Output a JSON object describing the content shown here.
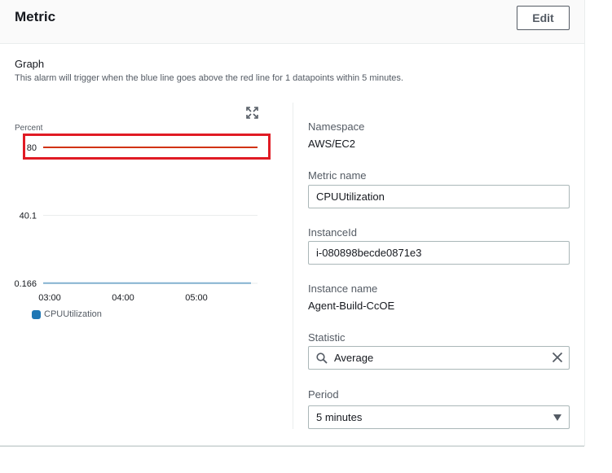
{
  "header": {
    "title": "Metric",
    "edit_label": "Edit"
  },
  "graph": {
    "title": "Graph",
    "description": "This alarm will trigger when the blue line goes above the red line for 1 datapoints within 5 minutes.",
    "expand_icon": "expand-icon"
  },
  "chart_data": {
    "type": "line",
    "ylabel": "Percent",
    "y_ticks": [
      "80",
      "40.1",
      "0.166"
    ],
    "x_ticks": [
      "03:00",
      "04:00",
      "05:00"
    ],
    "ylim": [
      0.166,
      80
    ],
    "threshold": {
      "value": 80,
      "color": "#d13212"
    },
    "series": [
      {
        "name": "CPUUtilization",
        "color": "#1f77b4",
        "values": [
          0.2,
          0.2,
          0.19,
          0.2,
          0.2,
          0.2,
          0.21,
          0.2,
          0.19,
          0.2,
          0.2,
          0.2
        ]
      }
    ]
  },
  "details": {
    "namespace_label": "Namespace",
    "namespace_value": "AWS/EC2",
    "metric_name_label": "Metric name",
    "metric_name_value": "CPUUtilization",
    "instance_id_label": "InstanceId",
    "instance_id_value": "i-080898becde0871e3",
    "instance_name_label": "Instance name",
    "instance_name_value": "Agent-Build-CcOE",
    "statistic_label": "Statistic",
    "statistic_value": "Average",
    "period_label": "Period",
    "period_value": "5 minutes"
  }
}
